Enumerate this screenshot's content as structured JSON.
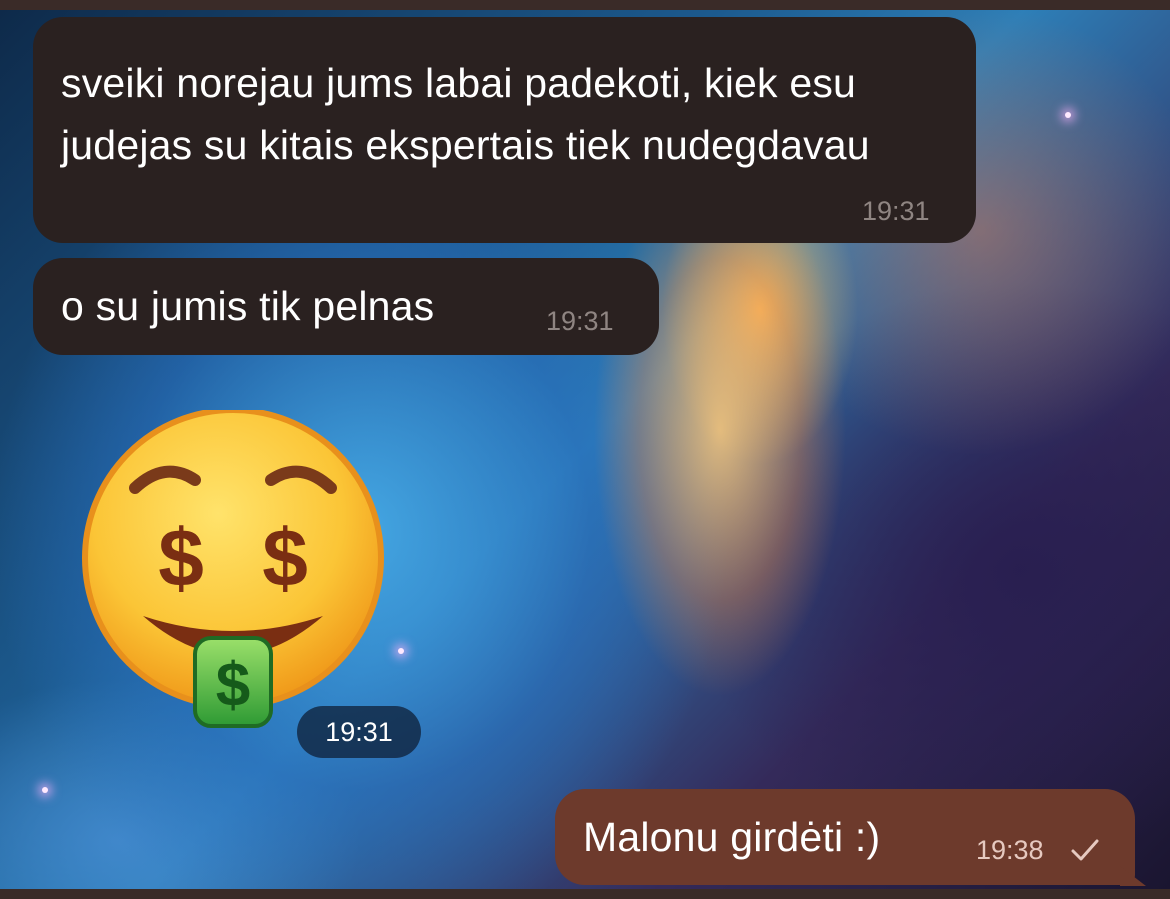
{
  "messages": [
    {
      "direction": "incoming",
      "text": "sveiki norejau jums labai padekoti, kiek esu judejas su kitais ekspertais tiek nudegdavau",
      "time": "19:31"
    },
    {
      "direction": "incoming",
      "text": "o su jumis tik pelnas",
      "time": "19:31"
    },
    {
      "direction": "incoming",
      "type": "sticker",
      "sticker": "money-mouth-face-icon",
      "time": "19:31"
    },
    {
      "direction": "outgoing",
      "text": "Malonu girdėti :)",
      "time": "19:38",
      "status": "sent-check-icon"
    }
  ],
  "colors": {
    "incoming_bubble": "#2a2120",
    "outgoing_bubble": "#6d3a2c",
    "time_incoming": "#8f8582",
    "time_outgoing": "#e6c9c0"
  }
}
